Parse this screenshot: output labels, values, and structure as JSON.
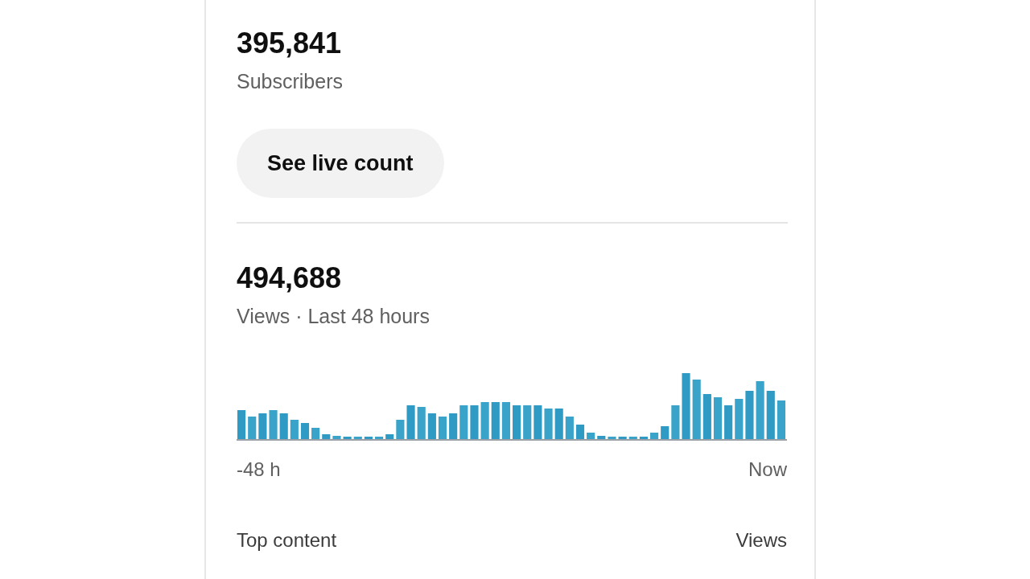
{
  "subscribers": {
    "count": "395,841",
    "label": "Subscribers",
    "button": "See live count"
  },
  "views": {
    "count": "494,688",
    "label": "Views · Last 48 hours",
    "axis_start": "-48 h",
    "axis_end": "Now"
  },
  "top_content": {
    "heading": "Top content",
    "column": "Views"
  }
}
